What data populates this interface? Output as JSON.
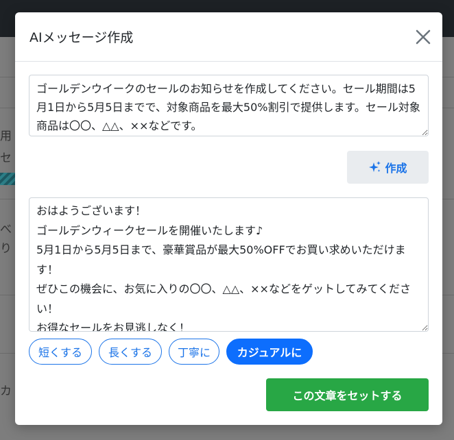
{
  "background": {
    "fragments": [
      "用",
      "セ",
      "べ",
      "り",
      "カ"
    ]
  },
  "modal": {
    "title": "AIメッセージ作成",
    "close_icon": "close-icon",
    "prompt": {
      "value": "ゴールデンウイークのセールのお知らせを作成してください。セール期間は5月1日から5月5日までで、対象商品を最大50%割引で提供します。セール対象商品は〇〇、△△、××などです。"
    },
    "generate_button": {
      "label": "作成",
      "icon": "sparkle-icon"
    },
    "result": {
      "value": "おはようございます！\nゴールデンウィークセールを開催いたします♪\n5月1日から5月5日まで、豪華賞品が最大50%OFFでお買い求めいただけます！\nぜひこの機会に、お気に入りの〇〇、△△、××などをゲットしてみてください！\nお得なセールをお見逃しなく！"
    },
    "tone_buttons": {
      "shorter": "短くする",
      "longer": "長くする",
      "polite": "丁寧に",
      "casual": "カジュアルに"
    },
    "set_button": {
      "label": "この文章をセットする"
    }
  },
  "colors": {
    "accent": "#1a73e8",
    "active_pill": "#0d6efd",
    "set_button": "#28a745"
  }
}
